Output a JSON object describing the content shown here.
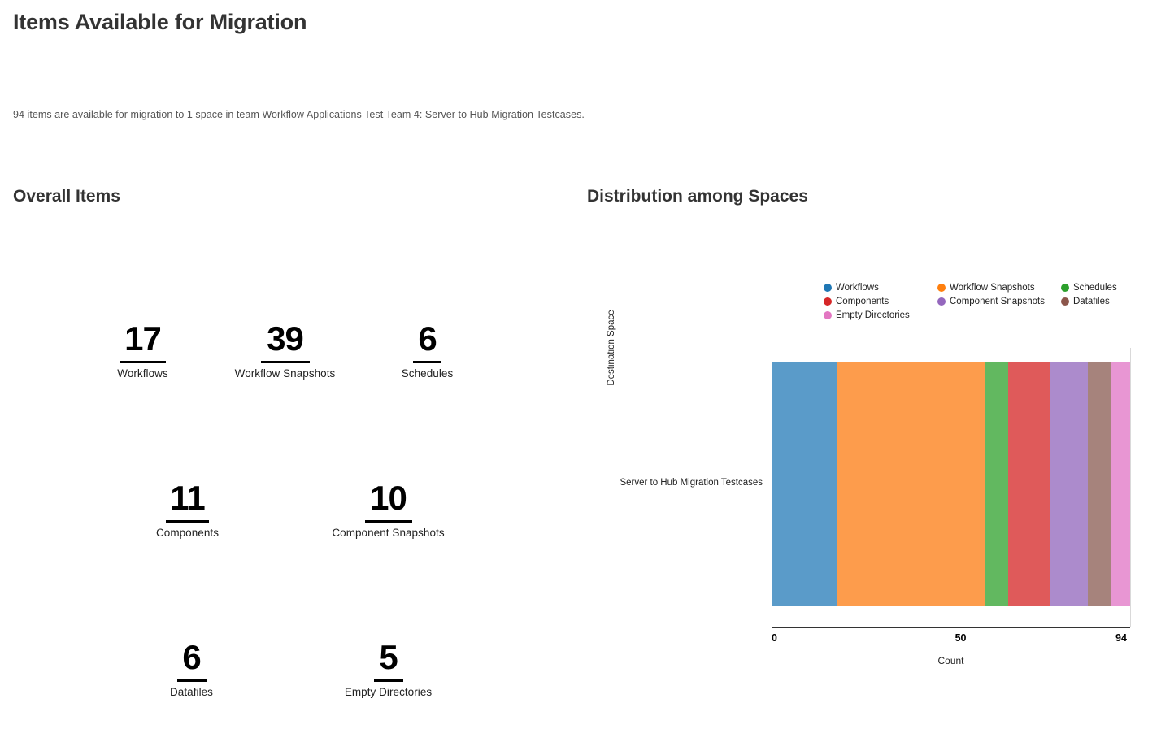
{
  "page": {
    "title": "Items Available for Migration",
    "subtitle": {
      "before_link": "94 items are available for migration to 1 space in team ",
      "link_text": "Workflow Applications Test Team 4",
      "after_link": ": Server to Hub Migration Testcases."
    }
  },
  "overall": {
    "heading": "Overall Items",
    "rows": [
      [
        {
          "value": "17",
          "label": "Workflows"
        },
        {
          "value": "39",
          "label": "Workflow Snapshots"
        },
        {
          "value": "6",
          "label": "Schedules"
        }
      ],
      [
        {
          "value": "11",
          "label": "Components"
        },
        {
          "value": "10",
          "label": "Component Snapshots"
        }
      ],
      [
        {
          "value": "6",
          "label": "Datafiles"
        },
        {
          "value": "5",
          "label": "Empty Directories"
        }
      ]
    ]
  },
  "distribution": {
    "heading": "Distribution among Spaces"
  },
  "chart_data": {
    "type": "bar",
    "orientation": "horizontal",
    "stacked": true,
    "title": "Distribution among Spaces",
    "xlabel": "Count",
    "ylabel": "Destination Space",
    "categories": [
      "Server to Hub Migration Testcases"
    ],
    "xlim": [
      0,
      94
    ],
    "xticks": [
      0,
      50,
      94
    ],
    "xtick_labels": [
      "0",
      "50",
      "94"
    ],
    "grid": true,
    "legend_position": "upper-center",
    "total": 94,
    "series": [
      {
        "name": "Workflows",
        "values": [
          17
        ],
        "legend_color": "#1f77b4",
        "bar_color": "#5a9bc9"
      },
      {
        "name": "Workflow Snapshots",
        "values": [
          39
        ],
        "legend_color": "#ff7f0e",
        "bar_color": "#fd9c4c"
      },
      {
        "name": "Schedules",
        "values": [
          6
        ],
        "legend_color": "#2ca02c",
        "bar_color": "#62b860"
      },
      {
        "name": "Components",
        "values": [
          11
        ],
        "legend_color": "#d62728",
        "bar_color": "#df5a5a"
      },
      {
        "name": "Component Snapshots",
        "values": [
          10
        ],
        "legend_color": "#9467bd",
        "bar_color": "#ac8bcc"
      },
      {
        "name": "Datafiles",
        "values": [
          6
        ],
        "legend_color": "#8c564b",
        "bar_color": "#a6837c"
      },
      {
        "name": "Empty Directories",
        "values": [
          5
        ],
        "legend_color": "#e377c2",
        "bar_color": "#e896d3"
      }
    ]
  }
}
